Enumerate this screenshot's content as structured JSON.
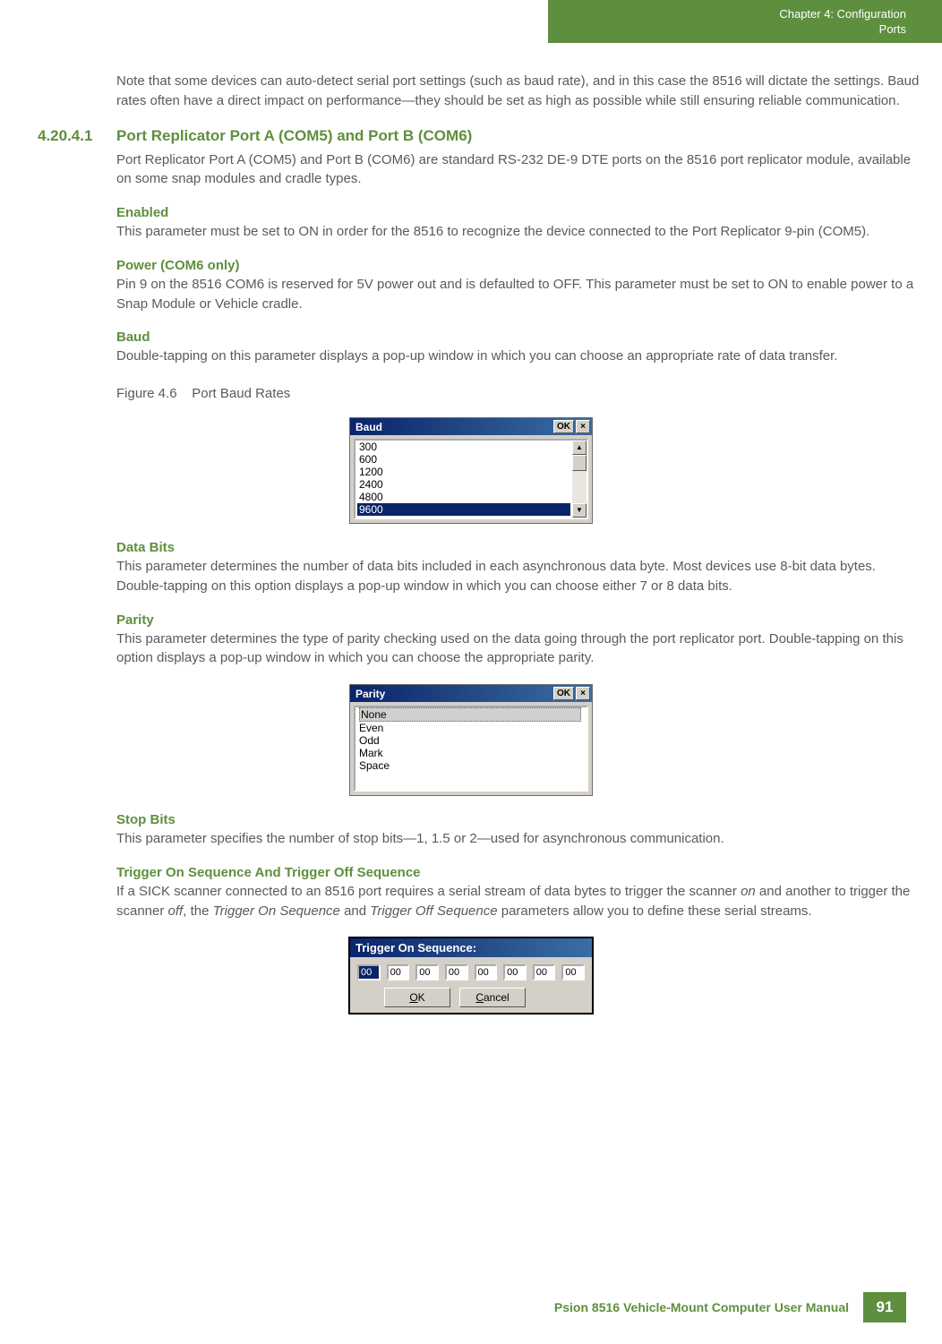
{
  "header": {
    "line1": "Chapter 4:  Configuration",
    "line2": "Ports"
  },
  "intro": "Note that some devices can auto-detect serial port settings (such as baud rate), and in this case the 8516 will dictate the settings. Baud rates often have a direct impact on performance—they should be set as high as possible while still ensuring reliable communication.",
  "section": {
    "num": "4.20.4.1",
    "title": "Port Replicator Port A (COM5) and Port B (COM6)",
    "para": "Port Replicator Port A (COM5) and Port B (COM6) are standard RS-232 DE-9 DTE ports on the 8516 port replicator module, available on some snap modules and cradle types."
  },
  "subs": {
    "enabled": {
      "h": "Enabled",
      "p": "This parameter must be set to ON in order for the 8516 to recognize the device connected to the Port Replicator 9-pin (COM5)."
    },
    "power": {
      "h": "Power (COM6 only)",
      "p": "Pin 9 on the 8516 COM6 is reserved for 5V power out and is defaulted to OFF. This parameter must be set to ON to enable power to a Snap Module or Vehicle cradle."
    },
    "baud": {
      "h": "Baud",
      "p": "Double-tapping on this parameter displays a pop-up window in which you can choose an appropriate rate of data transfer."
    },
    "databits": {
      "h": "Data Bits",
      "p": "This parameter determines the number of data bits included in each asynchronous data byte. Most devices use 8-bit data bytes. Double-tapping on this option displays a pop-up window in which you can choose either 7 or 8 data bits."
    },
    "parity": {
      "h": "Parity",
      "p": "This parameter determines the type of parity checking used on the data going through the port replicator port. Double-tapping on this option displays a pop-up window in which you can choose the appropriate parity."
    },
    "stopbits": {
      "h": "Stop Bits",
      "p": "This parameter specifies the number of stop bits—1, 1.5 or 2—used for asynchronous communication."
    },
    "trigger": {
      "h": "Trigger On Sequence And Trigger Off Sequence",
      "p_pre": "If a SICK scanner connected to an 8516 port requires a serial stream of data bytes to trigger the scanner ",
      "on": "on",
      "p_mid1": " and another to trigger the scanner ",
      "off": "off",
      "p_mid2": ", the ",
      "t_on": "Trigger On Sequence",
      "p_mid3": " and ",
      "t_off": "Trigger Off Sequence",
      "p_post": " parameters allow you to define these serial streams."
    }
  },
  "figure": {
    "num": "Figure 4.6",
    "title": "Port Baud Rates"
  },
  "baud_dialog": {
    "title": "Baud",
    "ok": "OK",
    "close": "×",
    "items": [
      "300",
      "600",
      "1200",
      "2400",
      "4800",
      "9600"
    ],
    "selected_index": 5,
    "scroll_up": "▲",
    "scroll_down": "▼"
  },
  "parity_dialog": {
    "title": "Parity",
    "ok": "OK",
    "close": "×",
    "items": [
      "None",
      "Even",
      "Odd",
      "Mark",
      "Space"
    ],
    "selected_index": 0
  },
  "trigger_dialog": {
    "title": "Trigger On Sequence:",
    "cells": [
      "00",
      "00",
      "00",
      "00",
      "00",
      "00",
      "00",
      "00"
    ],
    "selected_cell": 0,
    "ok_u": "O",
    "ok_rest": "K",
    "cancel_u": "C",
    "cancel_rest": "ancel"
  },
  "footer": {
    "text": "Psion 8516 Vehicle-Mount Computer User Manual",
    "page": "91"
  }
}
